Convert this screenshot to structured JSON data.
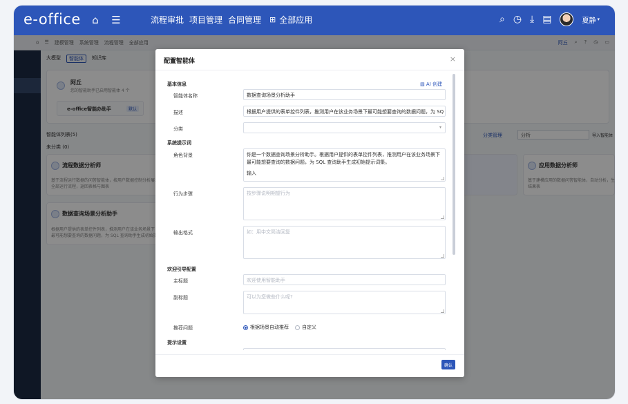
{
  "topbar": {
    "logo": "e-office",
    "nav": [
      "流程审批",
      "项目管理",
      "合同管理"
    ],
    "all_apps": "全部应用",
    "user": "夏静"
  },
  "background": {
    "crumbs": [
      "建模管理",
      "系统管理",
      "流程管理",
      "全部应用"
    ],
    "crumbs_right": "阿丘",
    "tabs": [
      "大模型",
      "智能体",
      "知识库"
    ],
    "assistant": {
      "name": "阿丘",
      "desc": "您的智能助手已启用智能体 4 个"
    },
    "eoffice_assistant": "e-office智能办助手",
    "default_tag": "默认",
    "list_title": "智能体列表(5)",
    "uncategorized": "未分类 (0)",
    "category_manage": "分类管理",
    "search_value": "分析",
    "import_label": "导入智能体",
    "cards": [
      {
        "title": "流程数据分析师",
        "desc": "基于流程运行数据的问答智能体，按用户数据控制分析展示",
        "desc2": "全部运行流程，返回表格与图表"
      },
      {
        "title": "数据查询场景分析助手",
        "desc": "根据用户提供的表单控件列表，推测用户在该业务场景下",
        "desc2": "最可能想要查询的数据问题，为 SQL 查询助手生成初始提示词"
      },
      {
        "title": "应用数据分析师",
        "desc": "基于建模应用的数据问答智能体，自动分析，生成查看",
        "desc2": "结果表"
      }
    ]
  },
  "modal": {
    "title": "配置智能体",
    "close": "×",
    "ai_create": "AI 创建",
    "sections": {
      "basic": "基本信息",
      "prompt": "系统提示词",
      "welcome": "欢迎引导配置",
      "tips": "提示设置"
    },
    "fields": {
      "name_label": "智能体名称",
      "name_value": "数据查询场景分析助手",
      "desc_label": "描述",
      "desc_value": "根据用户提供的表单控件列表，推测用户在该业务场景下最可能想要查询的数据问题，为 SQ",
      "category_label": "分类",
      "role_label": "角色背景",
      "role_value": "你是一个数据查询场景分析助手。根据用户提供的表单控件列表，推测用户在该业务场景下最可能想要查询的数据问题，为 SQL 查询助手生成初始提示词集。",
      "role_value2": "输入",
      "steps_label": "行为步骤",
      "steps_placeholder": "按步骤说明期望行为",
      "format_label": "输出格式",
      "format_placeholder": "如：用中文简洁回复",
      "main_title_label": "主标题",
      "main_title_placeholder": "欢迎使用智能助手",
      "sub_title_label": "副标题",
      "sub_title_placeholder": "可以为您做些什么呢?",
      "recommend_label": "推荐问题",
      "radio_auto": "根据场景自动推荐",
      "radio_custom": "自定义"
    },
    "confirm": "确认"
  }
}
